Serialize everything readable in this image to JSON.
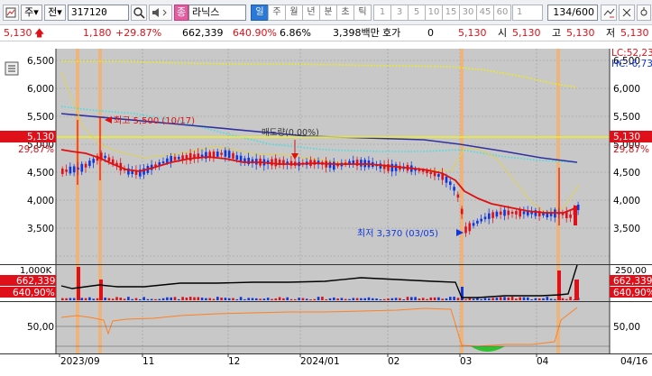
{
  "toolbar": {
    "mode": "주",
    "type": "전",
    "code": "317120",
    "stock_badge": "종",
    "stock_name": "라닉스",
    "periods": [
      "일",
      "주",
      "월",
      "년",
      "분",
      "초",
      "틱"
    ],
    "minutes": [
      "1",
      "3",
      "5",
      "10",
      "15",
      "30",
      "45",
      "60",
      "1"
    ],
    "count": "134/600"
  },
  "quote": {
    "price": "5,130",
    "change": "1,180",
    "change_pct": "+29.87%",
    "volume": "662,339",
    "volume_ratio": "640.90%",
    "turnover": "6.86%",
    "amount": "3,398백만",
    "bid_label": "호가",
    "bid_value": "0",
    "current": "5,130",
    "open_label": "시",
    "open": "5,130",
    "high_label": "고",
    "high": "5,130",
    "low_label": "저",
    "low": "5,130"
  },
  "price_axis": {
    "ticks": [
      "6,500",
      "6,000",
      "5,500",
      "5,000",
      "4,500",
      "4,000",
      "3,500"
    ],
    "right_ticks": [
      "6,500",
      "6,000",
      "5,500",
      "5,000",
      "4,500",
      "4,000",
      "3,500"
    ],
    "lc": "LC:52,23",
    "hc": "HC:-6,73",
    "current_badge": "5,130",
    "current_pct": "29,87%"
  },
  "annotations": {
    "high": "최고 5,500 (10/17)",
    "low": "최저 3,370 (03/05)",
    "trade": "매도량(0.00%)"
  },
  "volume_axis": {
    "left_top": "1,000K",
    "left_value": "662,339",
    "left_pct": "640,90%",
    "right_top": "250,00",
    "right_value": "662,339",
    "right_pct": "640,90%"
  },
  "osc_axis": {
    "left": "50,00",
    "right": "50,00"
  },
  "x_axis": {
    "labels": [
      "2023/09",
      "11",
      "12",
      "2024/01",
      "02",
      "03",
      "04"
    ],
    "right_label": "04/16"
  },
  "colors": {
    "up": "#e0101a",
    "down": "#1036e0",
    "ma": "#e01010",
    "long_ma": "#3030a0",
    "highlight": "#f5b070",
    "price_line": "#f0e020"
  }
}
